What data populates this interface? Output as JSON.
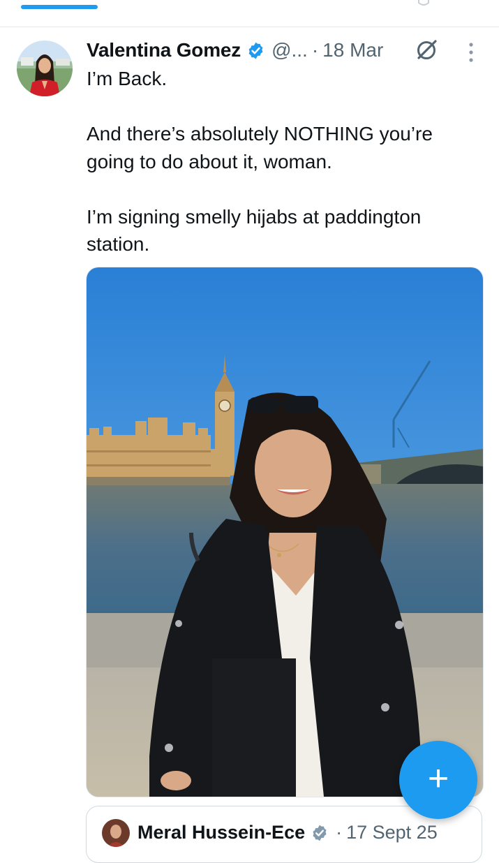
{
  "app": {
    "accent_color": "#1d9bf0",
    "muted_color": "#536471"
  },
  "tweet": {
    "author_name": "Valentina Gomez",
    "verified": true,
    "handle": "@...",
    "separator": "·",
    "date": "18 Mar",
    "icons": {
      "grok": "grok-slash-icon",
      "more": "vertical-ellipsis-icon",
      "verified": "verified-badge-icon"
    },
    "text": {
      "line1": "I’m Back.",
      "line2": "And there’s absolutely NOTHING you’re going to do about it, woman.",
      "line3": "I’m signing smelly hijabs at paddington station."
    }
  },
  "quoted_tweet": {
    "author_name": "Meral Hussein-Ece",
    "verified": true,
    "separator": "·",
    "date": "17 Sept 25"
  },
  "compose_button": {
    "label": "+",
    "icon": "plus-icon"
  }
}
